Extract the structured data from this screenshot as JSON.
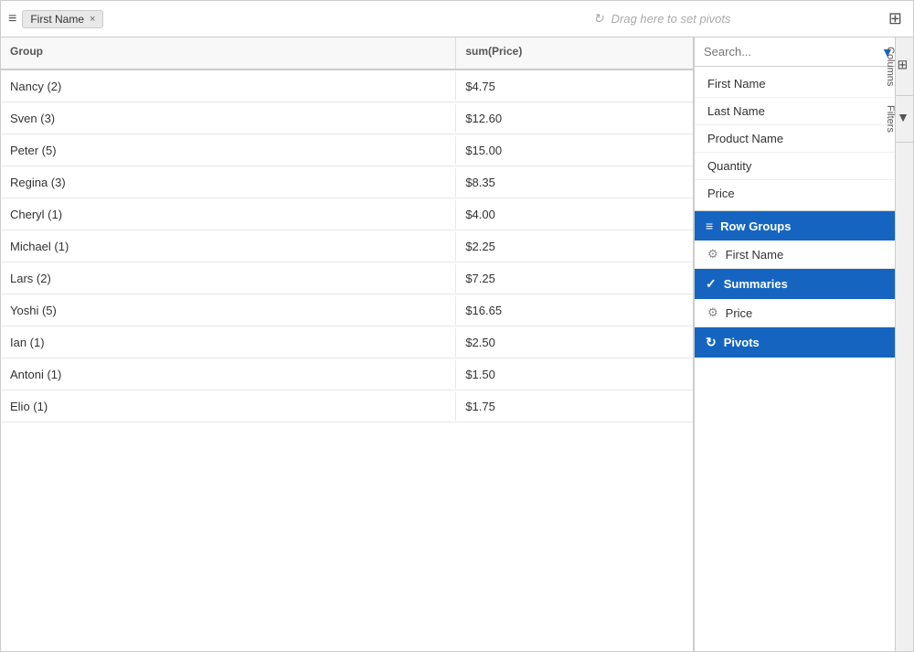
{
  "toolbar": {
    "hamburger": "≡",
    "chip_label": "First Name",
    "chip_close": "×",
    "pivot_placeholder": "Drag here to set pivots",
    "pivot_refresh_icon": "↻",
    "grid_icon": "⊞"
  },
  "grid": {
    "columns": [
      {
        "key": "group",
        "label": "Group"
      },
      {
        "key": "sumPrice",
        "label": "sum(Price)"
      }
    ],
    "rows": [
      {
        "group": "Nancy (2)",
        "sumPrice": "$4.75"
      },
      {
        "group": "Sven (3)",
        "sumPrice": "$12.60"
      },
      {
        "group": "Peter (5)",
        "sumPrice": "$15.00"
      },
      {
        "group": "Regina (3)",
        "sumPrice": "$8.35"
      },
      {
        "group": "Cheryl (1)",
        "sumPrice": "$4.00"
      },
      {
        "group": "Michael (1)",
        "sumPrice": "$2.25"
      },
      {
        "group": "Lars (2)",
        "sumPrice": "$7.25"
      },
      {
        "group": "Yoshi (5)",
        "sumPrice": "$16.65"
      },
      {
        "group": "Ian (1)",
        "sumPrice": "$2.50"
      },
      {
        "group": "Antoni (1)",
        "sumPrice": "$1.50"
      },
      {
        "group": "Elio (1)",
        "sumPrice": "$1.75"
      }
    ]
  },
  "sidePanel": {
    "search_placeholder": "Search...",
    "filter_icon": "▼",
    "columns_tab": "Columns",
    "filters_tab": "Filters",
    "columns_icon": "⊞",
    "filters_icon": "▼",
    "column_list": [
      "First Name",
      "Last Name",
      "Product Name",
      "Quantity",
      "Price"
    ],
    "row_groups_label": "Row Groups",
    "row_groups_icon": "≡",
    "row_groups_items": [
      "First Name"
    ],
    "summaries_label": "Summaries",
    "summaries_icon": "✓",
    "summaries_items": [
      "Price"
    ],
    "pivots_label": "Pivots",
    "pivots_icon": "↻"
  }
}
